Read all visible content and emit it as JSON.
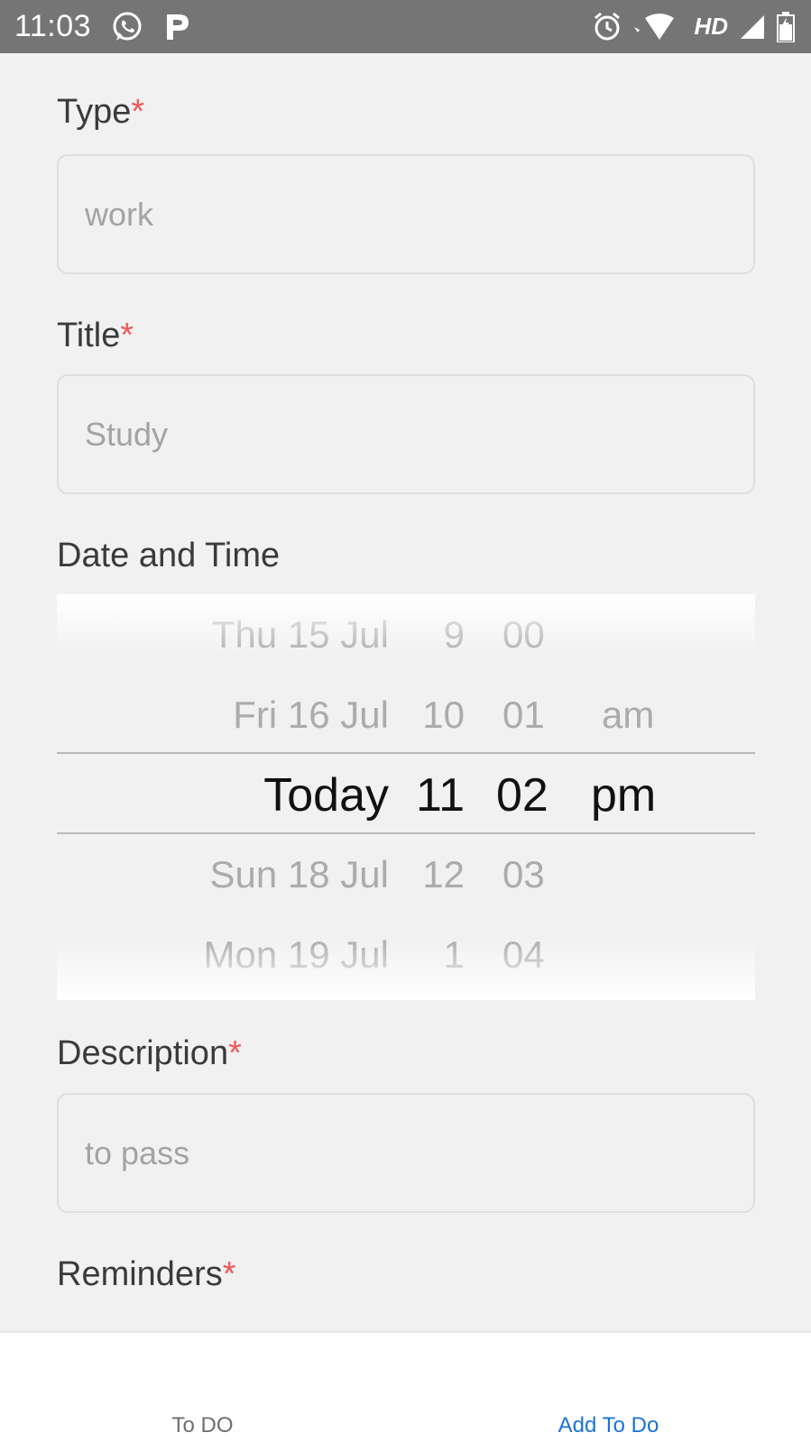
{
  "status_bar": {
    "time": "11:03",
    "left_icons": [
      "whatsapp-icon",
      "p-icon"
    ],
    "network_label": "HD",
    "right_icons": [
      "alarm-icon",
      "wifi-icon",
      "signal-icon",
      "battery-icon"
    ]
  },
  "form": {
    "type": {
      "label": "Type",
      "required_mark": "*",
      "value": "work"
    },
    "title": {
      "label": "Title",
      "required_mark": "*",
      "value": "Study"
    },
    "datetime": {
      "label": "Date and Time",
      "date_options": [
        "Thu 15 Jul",
        "Fri 16 Jul",
        "Today",
        "Sun 18 Jul",
        "Mon 19 Jul"
      ],
      "hour_options": [
        "9",
        "10",
        "11",
        "12",
        "1"
      ],
      "minute_options": [
        "00",
        "01",
        "02",
        "03",
        "04"
      ],
      "ampm_options": [
        "am",
        "pm"
      ],
      "selected": {
        "date": "Today",
        "hour": "11",
        "minute": "02",
        "ampm": "pm"
      }
    },
    "description": {
      "label": "Description",
      "required_mark": "*",
      "value": "to pass"
    },
    "reminders": {
      "label": "Reminders",
      "required_mark": "*"
    }
  },
  "bottom_nav": {
    "tabs": [
      {
        "label": "To DO",
        "active": false
      },
      {
        "label": "Add To Do",
        "active": true
      }
    ]
  },
  "colors": {
    "accent": "#1a73d6",
    "required": "#f0585a",
    "status_bar": "#757575",
    "background": "#f1f1f1"
  }
}
